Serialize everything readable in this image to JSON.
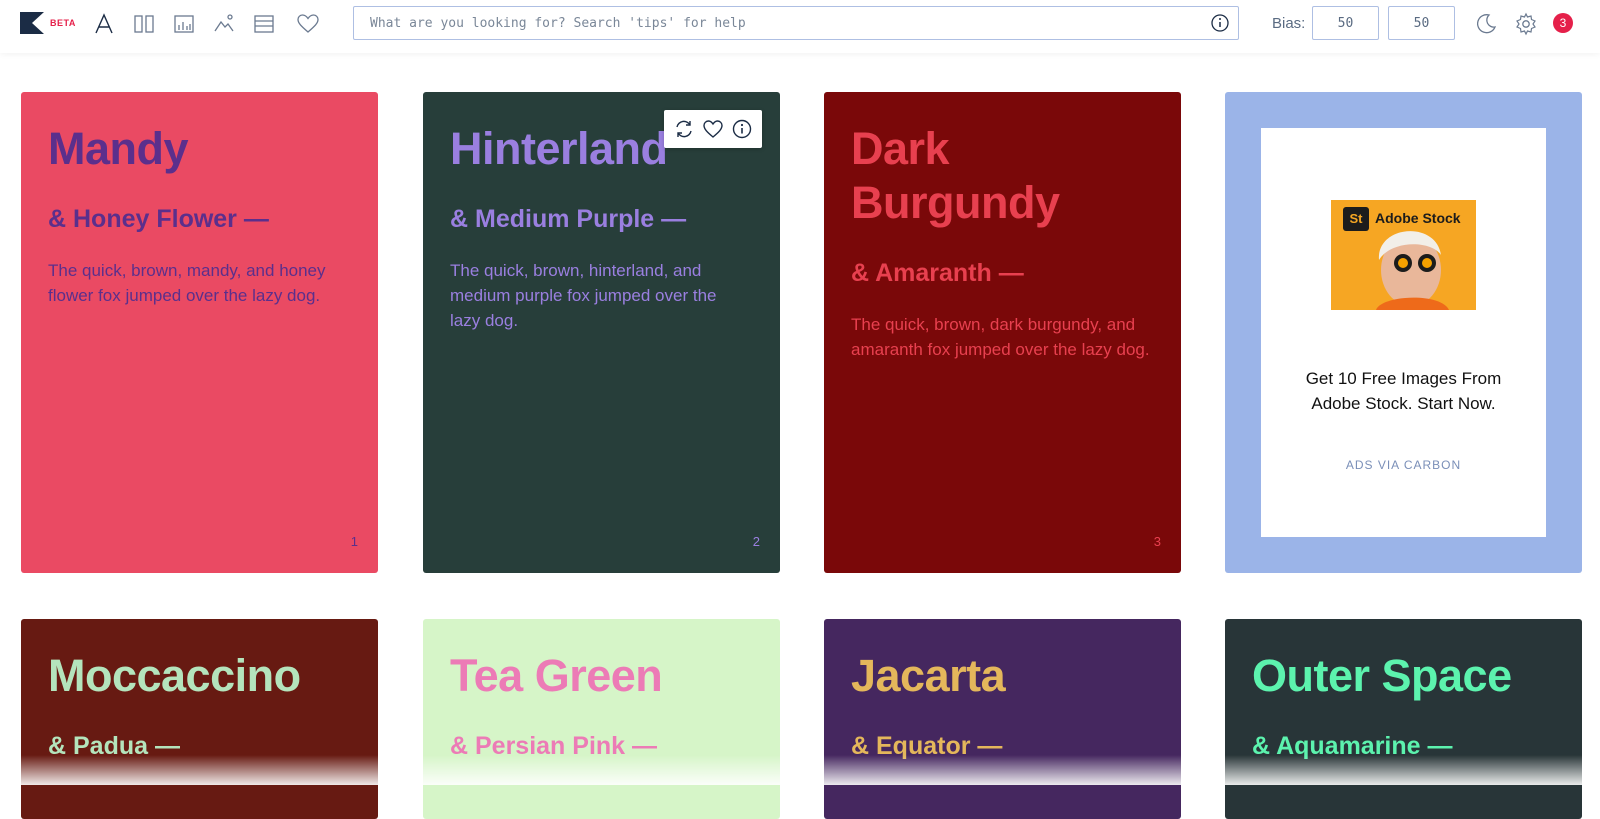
{
  "brand": {
    "badge": "BETA",
    "accent": "#e5204a"
  },
  "nav": [
    "typography-icon",
    "columns-icon",
    "chart-icon",
    "image-icon",
    "list-icon",
    "heart-icon"
  ],
  "search": {
    "placeholder": "What are you looking for? Search 'tips' for help",
    "value": ""
  },
  "bias": {
    "label": "Bias:",
    "values": [
      "50",
      "50"
    ]
  },
  "notifications": {
    "count": "3"
  },
  "cards": [
    {
      "name": "Mandy",
      "pair": "& Honey Flower —",
      "desc": "The quick, brown, mandy, and honey flower fox jumped over the lazy dog.",
      "num": "1",
      "bg": "#ea4a63",
      "fg": "#5b2f8c"
    },
    {
      "name": "Hinterland",
      "pair": "& Medium Purple —",
      "desc": "The quick, brown, hinterland, and medium purple fox jumped over the lazy dog.",
      "num": "2",
      "bg": "#273e3a",
      "fg": "#9a7fe0"
    },
    {
      "name": "Dark Burgundy",
      "pair": "& Amaranth —",
      "desc": "The quick, brown, dark burgundy, and amaranth fox jumped over the lazy dog.",
      "num": "3",
      "bg": "#7a0809",
      "fg": "#e8404f"
    },
    {
      "name": "Moccaccino",
      "pair": "& Padua —",
      "bg": "#671a12",
      "fg": "#b4e4bc"
    },
    {
      "name": "Tea Green",
      "pair": "& Persian Pink —",
      "bg": "#d6f5c8",
      "fg": "#ec7bb6"
    },
    {
      "name": "Jacarta",
      "pair": "& Equator —",
      "bg": "#45275f",
      "fg": "#e4b75b"
    },
    {
      "name": "Outer Space",
      "pair": "& Aquamarine —",
      "bg": "#283538",
      "fg": "#5cf3ae"
    }
  ],
  "ad": {
    "brand": "Adobe Stock",
    "logo": "St",
    "text": "Get 10 Free Images From Adobe Stock. Start Now.",
    "via": "ADS VIA CARBON"
  }
}
